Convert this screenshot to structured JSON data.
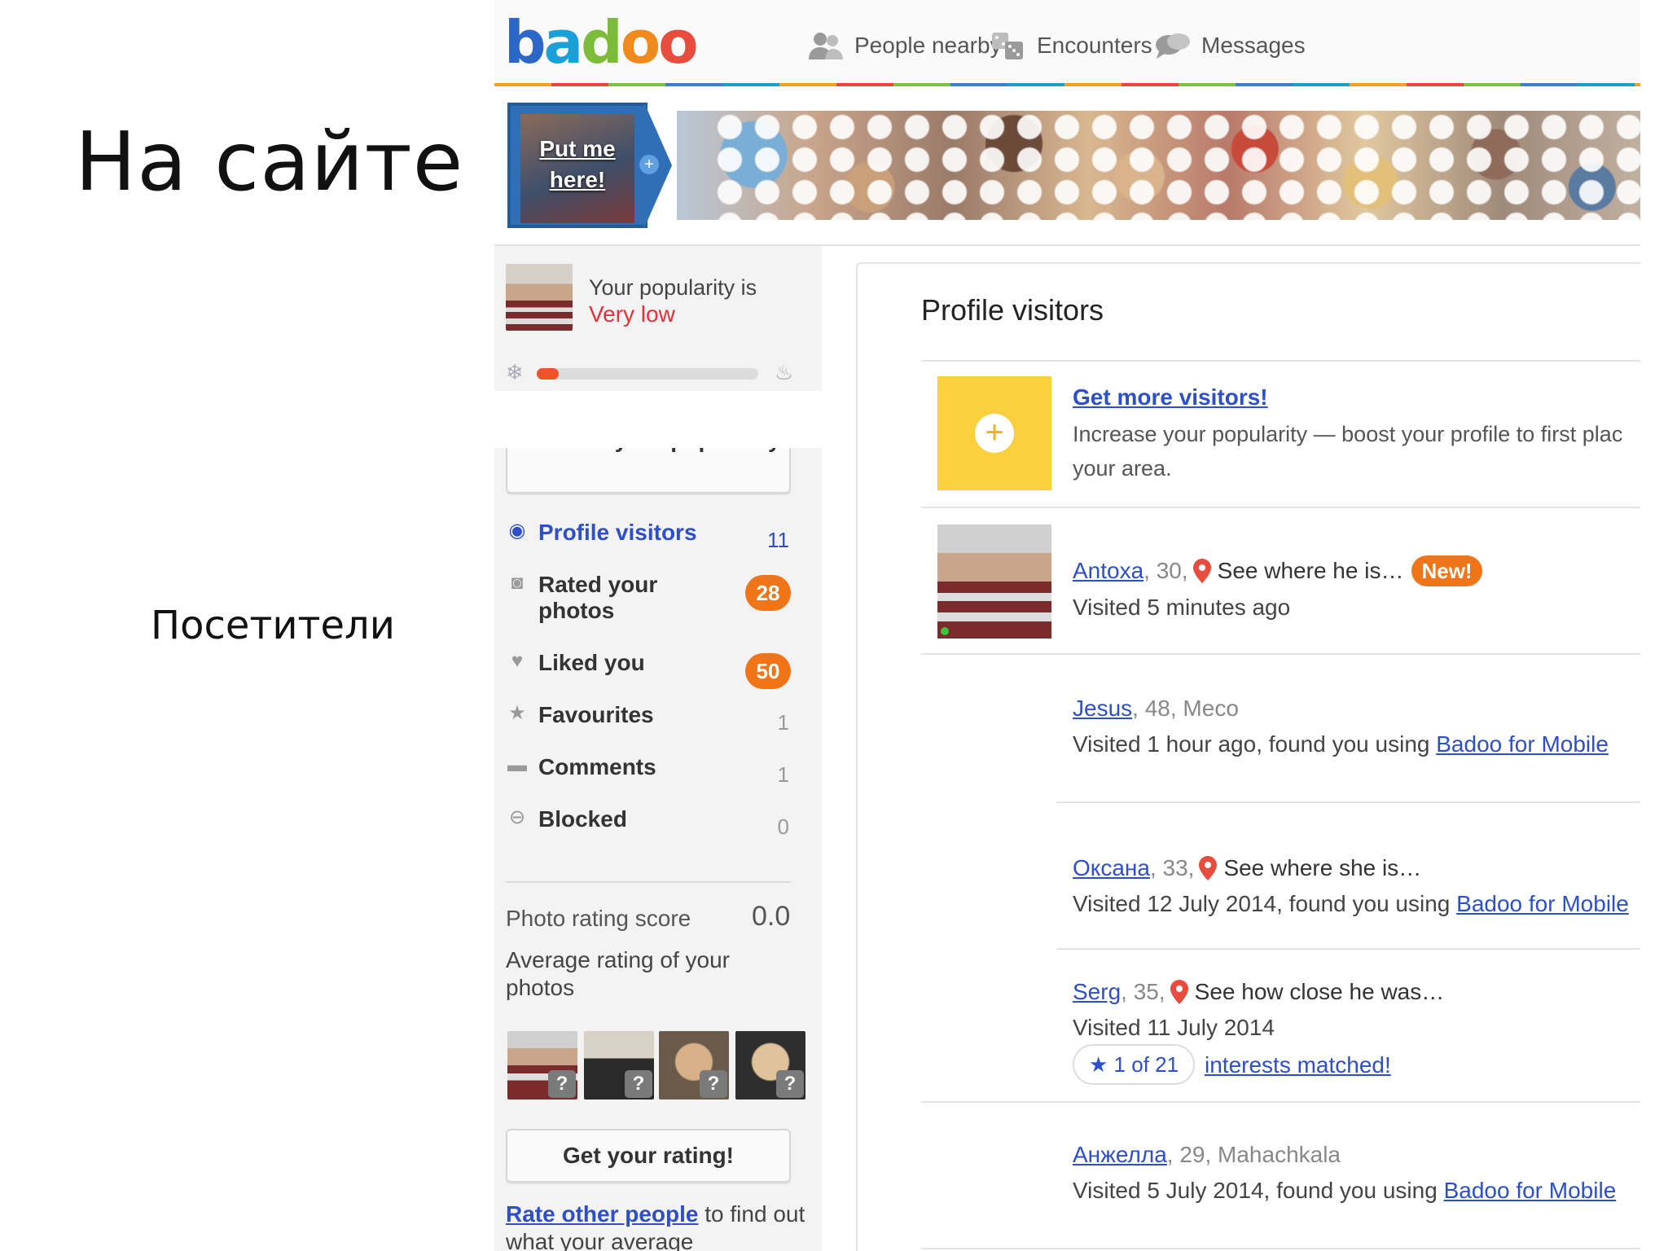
{
  "slide": {
    "title": "На сайте",
    "caption": "Посетители"
  },
  "app": {
    "logo": {
      "b": "b",
      "a": "a",
      "d": "d",
      "o1": "o",
      "o2": "o"
    },
    "nav": [
      {
        "label": "People nearby",
        "icon": "people-icon"
      },
      {
        "label": "Encounters",
        "icon": "dice-icon"
      },
      {
        "label": "Messages",
        "icon": "chat-bubbles-icon"
      }
    ],
    "colors": {
      "link": "#2d4fc9",
      "badge": "#f07418",
      "popularity_low": "#e2333c",
      "promo": "#fbd03e"
    }
  },
  "photostrip": {
    "put_me_line1": "Put me",
    "put_me_line2": "here!"
  },
  "sidebar": {
    "popularity_label": "Your popularity is",
    "popularity_value": "Very low",
    "popularity_level": 0.1,
    "increase_button": "Increase your popularity",
    "menu": [
      {
        "label": "Profile visitors",
        "count": "11",
        "icon": "eye-icon",
        "badge": false
      },
      {
        "label": "Rated your photos",
        "count": "28",
        "icon": "camera-icon",
        "badge": true
      },
      {
        "label": "Liked you",
        "count": "50",
        "icon": "heart-icon",
        "badge": true
      },
      {
        "label": "Favourites",
        "count": "1",
        "icon": "star-icon",
        "badge": false
      },
      {
        "label": "Comments",
        "count": "1",
        "icon": "comment-icon",
        "badge": false
      },
      {
        "label": "Blocked",
        "count": "0",
        "icon": "blocked-icon",
        "badge": false
      }
    ],
    "rating_label": "Photo rating score",
    "rating_value": "0.0",
    "rating_desc": "Average rating of your photos",
    "thumb_marker": "?",
    "get_rating_button": "Get your rating!",
    "rate_link": "Rate other people",
    "rate_text": " to find out what your average"
  },
  "main": {
    "title": "Profile visitors",
    "promo": {
      "link": "Get more visitors!",
      "line1": "Increase your popularity — boost your profile to first plac",
      "line2": "your area."
    },
    "visitors": [
      {
        "name": "Antoxa",
        "sep": " , 30,",
        "location": "See where he is…",
        "new": "New!",
        "visited": "Visited 5 minutes ago",
        "mobile": ""
      },
      {
        "name": "Jesus",
        "sep": " , 48, Meco",
        "location": "",
        "new": "",
        "visited": "Visited 1 hour ago, found you using ",
        "mobile": "Badoo for Mobile"
      },
      {
        "name": "Оксана",
        "sep": " , 33,",
        "location": "See where she is…",
        "new": "",
        "visited": "Visited 12 July 2014, found you using ",
        "mobile": "Badoo for Mobile"
      },
      {
        "name": "Serg",
        "sep": " , 35,",
        "location": "See how close he was…",
        "new": "",
        "visited": "Visited 11 July 2014",
        "mobile": ""
      },
      {
        "name": "Анжелла",
        "sep": " , 29, Mahachkala",
        "location": "",
        "new": "",
        "visited": "Visited 5 July 2014, found you using ",
        "mobile": "Badoo for Mobile"
      }
    ],
    "interests": {
      "pill": "1 of 21",
      "link": "interests matched!"
    }
  }
}
